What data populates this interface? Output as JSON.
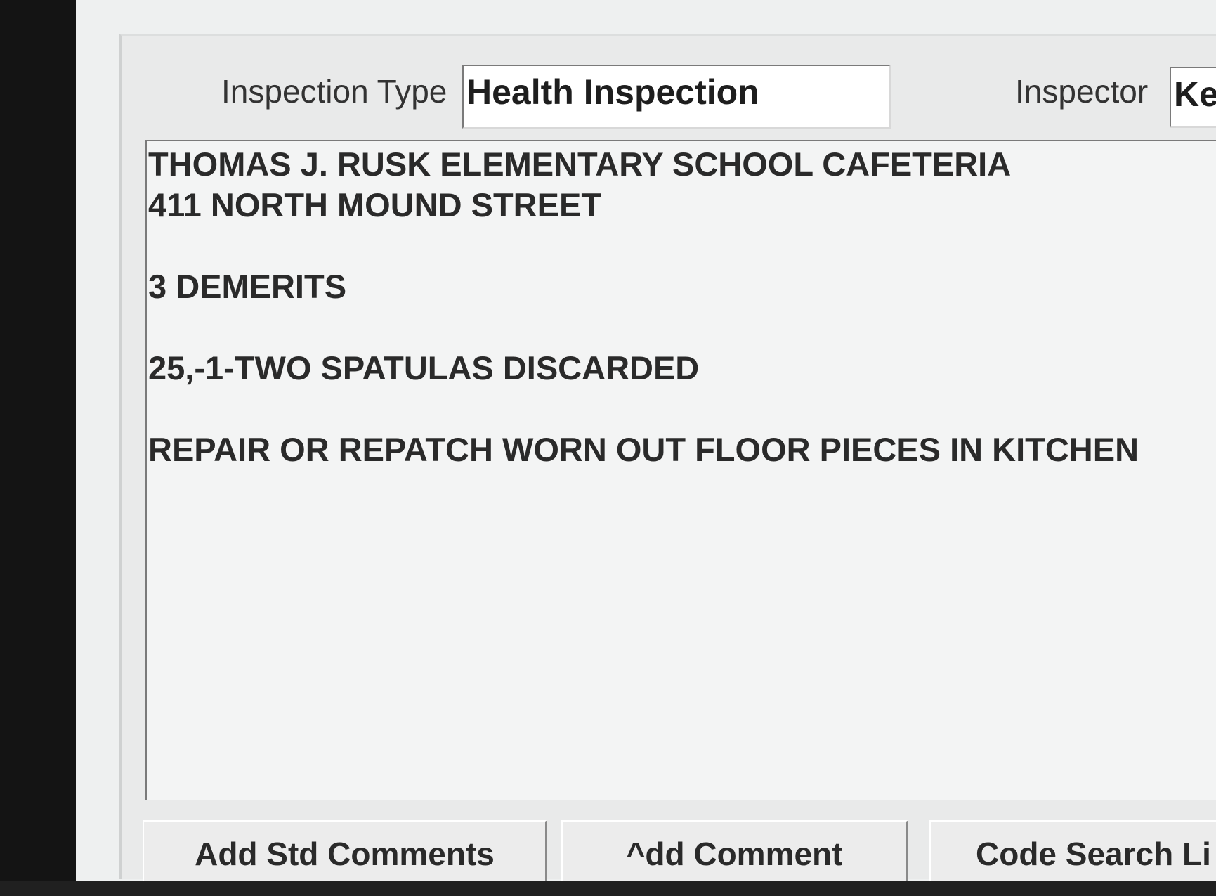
{
  "form": {
    "inspection_type_label": "Inspection Type",
    "inspection_type_value": "Health Inspection",
    "inspector_label": "Inspector",
    "inspector_value": "Ke"
  },
  "comments": {
    "lines": [
      "THOMAS J. RUSK ELEMENTARY SCHOOL CAFETERIA",
      "411 NORTH MOUND STREET",
      "",
      "3 DEMERITS",
      "",
      "25,-1-TWO SPATULAS DISCARDED",
      "",
      "REPAIR OR REPATCH WORN OUT FLOOR PIECES IN KITCHEN"
    ]
  },
  "buttons": {
    "add_std_comments": "Add Std Comments",
    "add_comment": "^dd Comment",
    "code_search": "Code Search Li"
  }
}
